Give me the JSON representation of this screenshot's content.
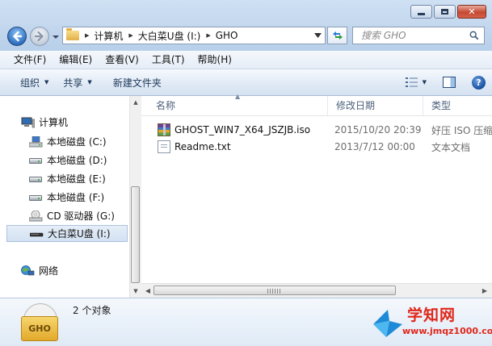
{
  "window": {
    "caption_buttons": [
      "minimize",
      "maximize",
      "close"
    ]
  },
  "address": {
    "crumbs": [
      "计算机",
      "大白菜U盘 (I:)",
      "GHO"
    ]
  },
  "search": {
    "placeholder": "搜索 GHO"
  },
  "menu": [
    "文件(F)",
    "编辑(E)",
    "查看(V)",
    "工具(T)",
    "帮助(H)"
  ],
  "commands": {
    "organize": "组织",
    "share": "共享",
    "new_folder": "新建文件夹"
  },
  "nav_tree": [
    {
      "label": "计算机",
      "icon": "computer-icon"
    },
    {
      "label": "本地磁盘 (C:)",
      "icon": "system-drive-icon"
    },
    {
      "label": "本地磁盘 (D:)",
      "icon": "drive-icon"
    },
    {
      "label": "本地磁盘 (E:)",
      "icon": "drive-icon"
    },
    {
      "label": "本地磁盘 (F:)",
      "icon": "drive-icon"
    },
    {
      "label": "CD 驱动器 (G:)",
      "icon": "cd-drive-icon"
    },
    {
      "label": "大白菜U盘 (I:)",
      "icon": "usb-drive-icon",
      "selected": true
    },
    {
      "label": "网络",
      "icon": "network-icon"
    }
  ],
  "columns": [
    "名称",
    "修改日期",
    "类型"
  ],
  "files": [
    {
      "name": "GHOST_WIN7_X64_JSZJB.iso",
      "date": "2015/10/20 20:39",
      "type": "好压 ISO 压缩",
      "icon": "archive-icon"
    },
    {
      "name": "Readme.txt",
      "date": "2013/7/12 00:00",
      "type": "文本文档",
      "icon": "text-file-icon"
    }
  ],
  "details": {
    "count": "2 个对象",
    "folder_label": "GHO"
  },
  "watermark": {
    "title": "学知网",
    "url": "www.jmqz1000.com"
  },
  "colors": {
    "accent": "#1e395b",
    "watermark": "#e0261a"
  }
}
